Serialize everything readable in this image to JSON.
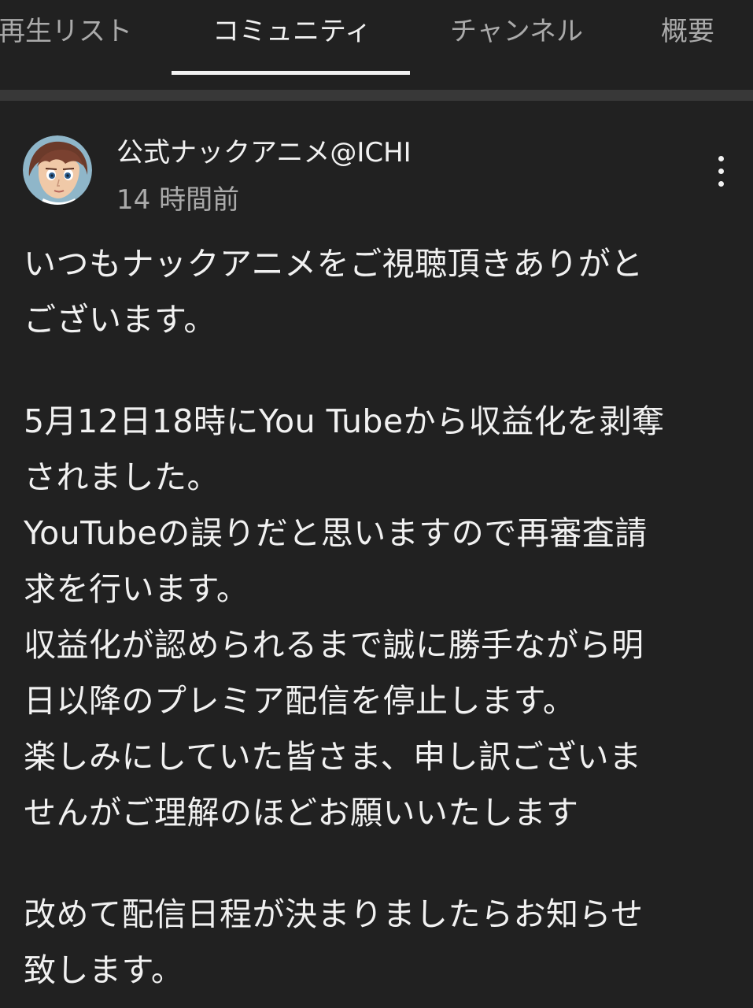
{
  "tabs": [
    {
      "label": "再生リスト",
      "active": false
    },
    {
      "label": "コミュニティ",
      "active": true
    },
    {
      "label": "チャンネル",
      "active": false
    },
    {
      "label": "概要",
      "active": false
    }
  ],
  "post": {
    "author": "公式ナックアニメ@ICHI",
    "time": "14 時間前",
    "more_icon": "vertical-ellipsis",
    "avatar_icon": "anime-character-avatar",
    "paragraphs": [
      "いつもナックアニメをご視聴頂きありがと\nございます。",
      "5月12日18時にYou Tubeから収益化を剥奪\nされました。\nYouTubeの誤りだと思いますので再審査請\n求を行います。\n収益化が認められるまで誠に勝手ながら明\n日以降のプレミア配信を停止します。\n楽しみにしていた皆さま、申し訳ございま\nせんがご理解のほどお願いいたします",
      "改めて配信日程が決まりましたらお知らせ\n致します。"
    ]
  },
  "colors": {
    "background": "#212121",
    "separator": "#383838",
    "text_primary": "#f1f1f1",
    "text_secondary": "#aaaaaa"
  }
}
